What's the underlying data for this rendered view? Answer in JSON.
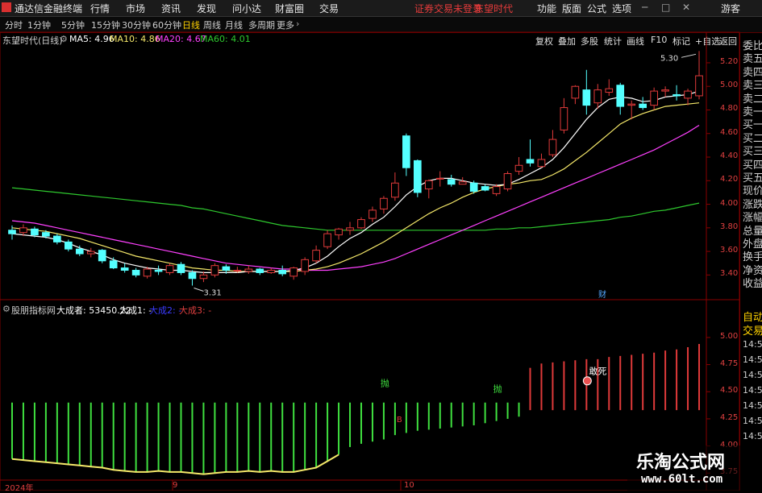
{
  "menubar": {
    "app_title": "通达信金融终端",
    "items": [
      "行情",
      "市场",
      "资讯",
      "发现",
      "问小达",
      "财富圈",
      "交易"
    ],
    "status": "证券交易未登录",
    "stock": "东望时代",
    "right_items": [
      "功能",
      "版面",
      "公式",
      "选项"
    ],
    "guest": "游客"
  },
  "periods": {
    "tabs": [
      "分时",
      "1分钟",
      "5分钟",
      "15分钟",
      "30分钟",
      "60分钟",
      "日线",
      "周线",
      "月线",
      "多周期",
      "更多"
    ],
    "active": "日线"
  },
  "toolbar": {
    "buttons": [
      "复权",
      "叠加",
      "多股",
      "统计",
      "画线",
      "F10",
      "标记",
      "+自选",
      "返回"
    ]
  },
  "main_chart": {
    "title": "东望时代(日线)",
    "ma5": "MA5: 4.96",
    "ma10": "MA10: 4.86",
    "ma20": "MA20: 4.67",
    "ma60": "MA60: 4.01",
    "high_label": "5.30",
    "low_label": "3.31",
    "event_label": "财",
    "price_ticks": [
      "5.20",
      "5.00",
      "4.80",
      "4.60",
      "4.40",
      "4.20",
      "4.00",
      "3.80",
      "3.60",
      "3.40"
    ],
    "colors": {
      "up": "#e03a3a",
      "down": "#54ffff",
      "ma5": "#ffffff",
      "ma10": "#f5e86a",
      "ma20": "#ff40ff",
      "ma60": "#2ec82e"
    }
  },
  "indicator": {
    "title": "股朋指标网",
    "value_label": "大成者: 53450.22",
    "line1": "大成1: -",
    "line2": "大成2: -",
    "line3": "大成3: -",
    "sell_labels": [
      "抛",
      "抛"
    ],
    "buy_label": "B",
    "signal_label": "敢死",
    "ticks": [
      "5.00",
      "4.75",
      "4.50",
      "4.25",
      "4.00",
      "3.75"
    ]
  },
  "xaxis": {
    "labels": [
      "2024年",
      "9",
      "10"
    ]
  },
  "sidepanel": {
    "items": [
      "委比",
      "卖五",
      "卖四",
      "卖三",
      "卖二",
      "卖一",
      "买一",
      "买二",
      "买三",
      "买四",
      "买五",
      "现价",
      "涨跌",
      "涨幅",
      "总量",
      "外盘",
      "换手",
      "净资",
      "收益",
      "自动",
      "交易"
    ],
    "times": [
      "14:55",
      "14:56",
      "14:56",
      "14:56",
      "14:56",
      "14:56",
      "14:56"
    ]
  },
  "watermark": {
    "line1": "乐淘公式网",
    "line2": "www.60lt.com"
  },
  "chart_data": [
    {
      "type": "candlestick",
      "title": "东望时代(日线)",
      "ylim": [
        3.3,
        5.35
      ],
      "candles": [
        [
          3.78,
          3.75,
          3.82,
          3.7
        ],
        [
          3.76,
          3.8,
          3.83,
          3.73
        ],
        [
          3.79,
          3.74,
          3.81,
          3.72
        ],
        [
          3.76,
          3.73,
          3.78,
          3.71
        ],
        [
          3.73,
          3.68,
          3.75,
          3.66
        ],
        [
          3.68,
          3.62,
          3.7,
          3.6
        ],
        [
          3.62,
          3.58,
          3.65,
          3.56
        ],
        [
          3.58,
          3.6,
          3.63,
          3.55
        ],
        [
          3.61,
          3.52,
          3.62,
          3.5
        ],
        [
          3.52,
          3.46,
          3.55,
          3.45
        ],
        [
          3.46,
          3.44,
          3.5,
          3.42
        ],
        [
          3.44,
          3.4,
          3.46,
          3.38
        ],
        [
          3.39,
          3.45,
          3.47,
          3.37
        ],
        [
          3.44,
          3.43,
          3.48,
          3.4
        ],
        [
          3.42,
          3.48,
          3.5,
          3.4
        ],
        [
          3.49,
          3.42,
          3.51,
          3.4
        ],
        [
          3.42,
          3.37,
          3.44,
          3.31
        ],
        [
          3.37,
          3.4,
          3.43,
          3.34
        ],
        [
          3.4,
          3.48,
          3.5,
          3.38
        ],
        [
          3.47,
          3.44,
          3.49,
          3.41
        ],
        [
          3.44,
          3.44,
          3.47,
          3.42
        ],
        [
          3.43,
          3.45,
          3.48,
          3.41
        ],
        [
          3.45,
          3.42,
          3.46,
          3.4
        ],
        [
          3.42,
          3.44,
          3.46,
          3.41
        ],
        [
          3.44,
          3.41,
          3.48,
          3.39
        ],
        [
          3.39,
          3.46,
          3.47,
          3.36
        ],
        [
          3.43,
          3.53,
          3.55,
          3.4
        ],
        [
          3.52,
          3.61,
          3.65,
          3.5
        ],
        [
          3.64,
          3.75,
          3.78,
          3.62
        ],
        [
          3.74,
          3.79,
          3.8,
          3.7
        ],
        [
          3.78,
          3.8,
          3.85,
          3.74
        ],
        [
          3.8,
          3.87,
          3.89,
          3.79
        ],
        [
          3.88,
          3.95,
          3.98,
          3.85
        ],
        [
          3.96,
          4.05,
          4.07,
          3.92
        ],
        [
          4.06,
          4.18,
          4.27,
          4.03
        ],
        [
          4.58,
          4.31,
          4.6,
          4.24
        ],
        [
          4.37,
          4.1,
          4.38,
          4.06
        ],
        [
          4.13,
          4.2,
          4.21,
          4.05
        ],
        [
          4.22,
          4.22,
          4.28,
          4.15
        ],
        [
          4.21,
          4.17,
          4.25,
          4.15
        ],
        [
          4.17,
          4.19,
          4.23,
          4.17
        ],
        [
          4.18,
          4.11,
          4.2,
          4.09
        ],
        [
          4.15,
          4.12,
          4.17,
          4.11
        ],
        [
          4.09,
          4.15,
          4.17,
          4.07
        ],
        [
          4.13,
          4.26,
          4.28,
          4.11
        ],
        [
          4.28,
          4.33,
          4.4,
          4.25
        ],
        [
          4.38,
          4.35,
          4.55,
          4.32
        ],
        [
          4.32,
          4.38,
          4.43,
          4.31
        ],
        [
          4.42,
          4.55,
          4.63,
          4.4
        ],
        [
          4.63,
          4.82,
          4.9,
          4.6
        ],
        [
          4.9,
          5.0,
          5.01,
          4.85
        ],
        [
          4.97,
          4.84,
          5.14,
          4.76
        ],
        [
          4.86,
          4.97,
          5.02,
          4.81
        ],
        [
          4.95,
          4.98,
          5.06,
          4.92
        ],
        [
          5.01,
          4.83,
          5.03,
          4.76
        ],
        [
          4.84,
          4.85,
          4.88,
          4.72
        ],
        [
          4.85,
          4.82,
          4.91,
          4.8
        ],
        [
          4.84,
          4.96,
          4.99,
          4.8
        ],
        [
          4.96,
          4.97,
          5.0,
          4.91
        ],
        [
          4.93,
          4.92,
          5.01,
          4.88
        ],
        [
          4.9,
          4.96,
          4.98,
          4.84
        ],
        [
          4.92,
          5.09,
          5.3,
          4.89
        ]
      ],
      "ma5": [
        3.75,
        3.74,
        3.73,
        3.72,
        3.7,
        3.67,
        3.63,
        3.6,
        3.57,
        3.53,
        3.5,
        3.48,
        3.46,
        3.45,
        3.44,
        3.44,
        3.43,
        3.42,
        3.42,
        3.42,
        3.42,
        3.43,
        3.43,
        3.43,
        3.43,
        3.44,
        3.46,
        3.5,
        3.56,
        3.64,
        3.71,
        3.76,
        3.83,
        3.89,
        3.98,
        4.08,
        4.15,
        4.2,
        4.22,
        4.22,
        4.2,
        4.18,
        4.17,
        4.16,
        4.17,
        4.21,
        4.26,
        4.31,
        4.38,
        4.48,
        4.6,
        4.72,
        4.82,
        4.89,
        4.91,
        4.9,
        4.87,
        4.88,
        4.91,
        4.92,
        4.93,
        4.96
      ],
      "ma10": [
        3.8,
        3.79,
        3.78,
        3.77,
        3.75,
        3.73,
        3.71,
        3.68,
        3.65,
        3.62,
        3.59,
        3.56,
        3.54,
        3.52,
        3.5,
        3.48,
        3.46,
        3.45,
        3.44,
        3.44,
        3.43,
        3.43,
        3.43,
        3.43,
        3.43,
        3.43,
        3.44,
        3.45,
        3.47,
        3.5,
        3.54,
        3.58,
        3.63,
        3.68,
        3.74,
        3.8,
        3.86,
        3.92,
        3.97,
        4.01,
        4.06,
        4.1,
        4.13,
        4.15,
        4.17,
        4.18,
        4.2,
        4.21,
        4.25,
        4.3,
        4.37,
        4.44,
        4.52,
        4.6,
        4.68,
        4.73,
        4.77,
        4.8,
        4.83,
        4.84,
        4.85,
        4.86
      ],
      "ma20": [
        3.86,
        3.85,
        3.84,
        3.82,
        3.8,
        3.78,
        3.76,
        3.74,
        3.72,
        3.7,
        3.68,
        3.66,
        3.64,
        3.62,
        3.6,
        3.58,
        3.56,
        3.54,
        3.52,
        3.5,
        3.49,
        3.48,
        3.47,
        3.46,
        3.45,
        3.45,
        3.44,
        3.44,
        3.44,
        3.45,
        3.46,
        3.47,
        3.49,
        3.51,
        3.54,
        3.58,
        3.62,
        3.66,
        3.7,
        3.74,
        3.78,
        3.82,
        3.86,
        3.9,
        3.94,
        3.98,
        4.02,
        4.06,
        4.1,
        4.14,
        4.18,
        4.22,
        4.26,
        4.3,
        4.34,
        4.38,
        4.42,
        4.46,
        4.51,
        4.56,
        4.61,
        4.67
      ],
      "ma60": [
        4.14,
        4.13,
        4.12,
        4.11,
        4.1,
        4.09,
        4.08,
        4.07,
        4.06,
        4.05,
        4.04,
        4.03,
        4.02,
        4.01,
        4.0,
        3.99,
        3.97,
        3.96,
        3.94,
        3.92,
        3.9,
        3.88,
        3.86,
        3.84,
        3.82,
        3.81,
        3.8,
        3.79,
        3.78,
        3.78,
        3.78,
        3.78,
        3.78,
        3.78,
        3.78,
        3.78,
        3.78,
        3.78,
        3.78,
        3.78,
        3.78,
        3.78,
        3.78,
        3.79,
        3.79,
        3.8,
        3.8,
        3.81,
        3.82,
        3.83,
        3.84,
        3.85,
        3.86,
        3.87,
        3.89,
        3.9,
        3.92,
        3.94,
        3.95,
        3.97,
        3.99,
        4.01
      ]
    },
    {
      "type": "bar",
      "title": "股朋指标网",
      "ylim": [
        3.7,
        5.2
      ],
      "baseline": 4.3,
      "values": [
        4.4,
        4.4,
        4.4,
        4.4,
        4.4,
        4.4,
        4.4,
        4.4,
        4.4,
        4.4,
        4.4,
        4.4,
        4.4,
        4.4,
        4.4,
        4.4,
        4.4,
        4.4,
        4.4,
        4.4,
        4.4,
        4.4,
        4.4,
        4.4,
        4.4,
        4.4,
        4.4,
        4.4,
        4.4,
        4.4,
        4.4,
        4.4,
        4.4,
        4.4,
        4.4,
        4.4,
        4.4,
        4.4,
        4.4,
        4.4,
        4.4,
        4.4,
        4.4,
        4.4,
        4.4,
        4.4,
        4.4,
        4.4,
        4.4,
        4.4,
        4.4,
        4.4,
        4.4,
        4.4,
        4.4,
        4.4,
        4.4,
        4.4,
        4.4,
        4.4,
        4.4,
        4.4
      ],
      "lows": [
        3.88,
        3.87,
        3.86,
        3.85,
        3.84,
        3.83,
        3.82,
        3.81,
        3.8,
        3.78,
        3.77,
        3.76,
        3.76,
        3.77,
        3.76,
        3.76,
        3.75,
        3.74,
        3.75,
        3.76,
        3.76,
        3.77,
        3.76,
        3.77,
        3.76,
        3.76,
        3.78,
        3.8,
        3.86,
        3.92,
        3.99,
        4.02,
        4.04,
        4.06,
        4.1,
        4.12,
        4.14,
        4.15,
        4.16,
        4.17,
        4.18,
        4.19,
        4.21,
        4.23,
        4.25,
        4.27,
        4.29,
        4.31,
        4.32,
        4.33,
        4.35,
        4.34,
        4.36,
        4.37,
        4.38,
        4.39,
        4.38,
        4.37,
        4.36,
        4.36,
        4.35,
        4.34
      ],
      "highs": [
        4.72,
        4.76,
        4.77,
        4.78,
        4.79,
        4.8,
        4.8,
        4.82,
        4.83,
        4.84,
        4.85,
        4.86,
        4.88,
        4.89,
        4.91,
        4.94
      ]
    }
  ]
}
